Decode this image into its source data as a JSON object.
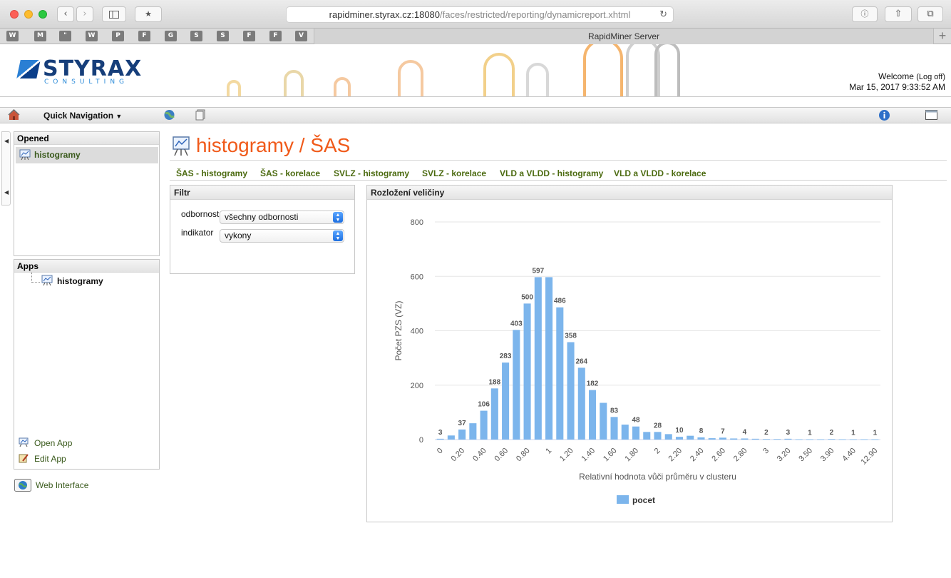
{
  "browser": {
    "url_host": "rapidminer.styrax.cz:18080",
    "url_path": "/faces/restricted/reporting/dynamicreport.xhtml",
    "tab_title": "RapidMiner Server",
    "bookmarks": [
      "W",
      "M",
      "\"",
      "W",
      "P",
      "F",
      "G",
      "S",
      "S",
      "F",
      "F",
      "V"
    ]
  },
  "header": {
    "logo_text": "STYRAX",
    "logo_subtext": "CONSULTING",
    "welcome": "Welcome",
    "logoff": "(Log off)",
    "datetime": "Mar 15, 2017 9:33:52 AM"
  },
  "toolbar": {
    "quick_nav": "Quick Navigation"
  },
  "sidebar": {
    "opened_header": "Opened",
    "opened_item": "histogramy",
    "apps_header": "Apps",
    "apps_item": "histogramy",
    "open_app": "Open App",
    "edit_app": "Edit App",
    "web_interface": "Web Interface"
  },
  "main": {
    "title": "histogramy / ŠAS",
    "tabs": [
      "ŠAS - histogramy",
      "ŠAS - korelace",
      "SVLZ - histogramy",
      "SVLZ - korelace",
      "VLD a VLDD - histogramy",
      "VLD a VLDD - korelace"
    ],
    "filter": {
      "header": "Filtr",
      "label1": "odbornost",
      "value1": "všechny odbornosti",
      "label2": "indikator",
      "value2": "vykony"
    },
    "chart_header": "Rozložení veličiny"
  },
  "colors": {
    "bar": "#7cb5ec",
    "accent_title": "#f05a1a",
    "link_green": "#4b6a0f"
  },
  "chart_data": {
    "type": "bar",
    "xlabel": "Relativní hodnota vůči průměru v clusteru",
    "ylabel": "Počet PZS (VZ)",
    "ylim": [
      0,
      800
    ],
    "yticks": [
      0,
      200,
      400,
      600,
      800
    ],
    "grid": true,
    "legend_position": "bottom-center",
    "series": [
      {
        "name": "pocet",
        "x": [
          "0",
          "0.10",
          "0.20",
          "0.30",
          "0.40",
          "0.50",
          "0.60",
          "0.70",
          "0.80",
          "0.90",
          "1",
          "1.10",
          "1.20",
          "1.30",
          "1.40",
          "1.50",
          "1.60",
          "1.70",
          "1.80",
          "1.90",
          "2",
          "2.10",
          "2.20",
          "2.30",
          "2.40",
          "2.50",
          "2.60",
          "2.70",
          "2.80",
          "2.90",
          "3",
          "3.10",
          "3.20",
          "3.40",
          "3.50",
          "3.70",
          "3.90",
          "4.10",
          "4.40",
          "4.60",
          "12.90"
        ],
        "values": [
          3,
          15,
          37,
          60,
          106,
          188,
          283,
          403,
          500,
          597,
          597,
          486,
          358,
          264,
          182,
          135,
          83,
          55,
          48,
          28,
          28,
          20,
          10,
          14,
          8,
          5,
          7,
          4,
          4,
          3,
          2,
          2,
          3,
          1,
          1,
          1,
          2,
          1,
          1,
          1,
          1
        ]
      }
    ],
    "x_tick_labels": [
      "0",
      "0.20",
      "0.40",
      "0.60",
      "0.80",
      "1",
      "1.20",
      "1.40",
      "1.60",
      "1.80",
      "2",
      "2.20",
      "2.40",
      "2.60",
      "2.80",
      "3",
      "3.20",
      "3.50",
      "3.90",
      "4.40",
      "12.90"
    ],
    "data_labels": {
      "0": "3",
      "2": "37",
      "4": "106",
      "5": "188",
      "6": "283",
      "7": "403",
      "8": "500",
      "9": "597",
      "11": "486",
      "12": "358",
      "13": "264",
      "14": "182",
      "16": "83",
      "18": "48",
      "20": "28",
      "22": "10",
      "24": "8",
      "26": "7",
      "28": "4",
      "30": "2",
      "32": "3",
      "34": "1",
      "36": "2",
      "38": "1",
      "40": "1"
    }
  }
}
